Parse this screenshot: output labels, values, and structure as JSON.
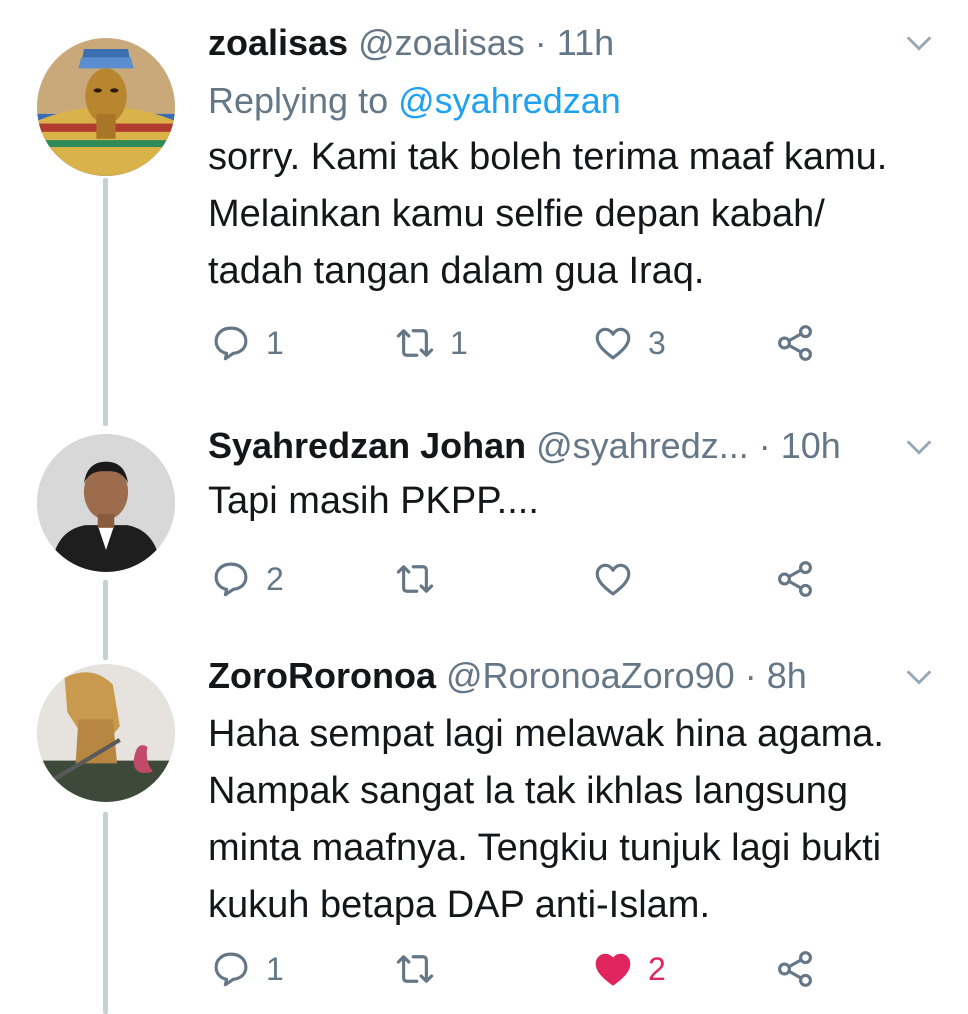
{
  "tweets": [
    {
      "name": "zoalisas",
      "handle": "@zoalisas",
      "separator": "·",
      "time": "11h",
      "replying_label": "Replying to",
      "replying_to": "@syahredzan",
      "text_lines": [
        "sorry. Kami tak boleh terima maaf kamu.",
        "Melainkan kamu selfie depan kabah/",
        "tadah tangan dalam gua Iraq."
      ],
      "replies": "1",
      "retweets": "1",
      "likes": "3",
      "liked": false
    },
    {
      "name": "Syahredzan Johan",
      "handle": "@syahredz...",
      "separator": "·",
      "time": "10h",
      "text_lines": [
        "Tapi masih PKPP...."
      ],
      "replies": "2",
      "retweets": "",
      "likes": "",
      "liked": false
    },
    {
      "name": "ZoroRoronoa",
      "handle": "@RoronoaZoro90",
      "separator": "·",
      "time": "8h",
      "text_lines": [
        "Haha sempat lagi melawak hina agama.",
        "Nampak sangat la tak ikhlas langsung",
        "minta maafnya. Tengkiu tunjuk lagi bukti",
        "kukuh betapa DAP anti-Islam."
      ],
      "replies": "1",
      "retweets": "",
      "likes": "2",
      "liked": true
    }
  ],
  "icons": {
    "reply": "reply-icon",
    "retweet": "retweet-icon",
    "like": "heart-icon",
    "share": "share-icon",
    "menu": "chevron-down-icon"
  },
  "colors": {
    "text": "#14171a",
    "muted": "#657786",
    "link": "#1da1f2",
    "like_active": "#e0245e",
    "thread_line": "#c5d0d8"
  }
}
